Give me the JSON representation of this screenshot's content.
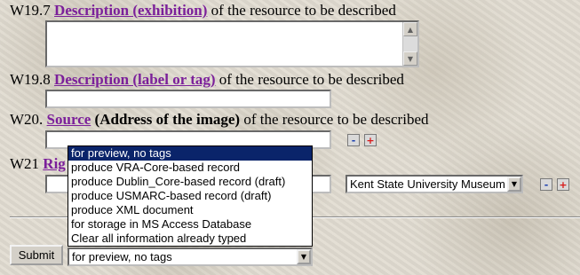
{
  "w19_7": {
    "number": "W19.7",
    "link": "Description (exhibition)",
    "suffix": "of the resource to be described",
    "value": ""
  },
  "w19_8": {
    "number": "W19.8",
    "link": "Description (label or tag)",
    "suffix": "of the resource to be described",
    "value": ""
  },
  "w20": {
    "number": "W20.",
    "link": "Source",
    "bold": "(Address of the image)",
    "suffix": "of the resource to be described",
    "value": ""
  },
  "w21": {
    "number": "W21",
    "link_visible": "Rig",
    "value": "",
    "select_value": "Kent State University Museum"
  },
  "controls": {
    "minus": "-",
    "plus": "+"
  },
  "output_format": {
    "options": [
      "for preview, no tags",
      "produce VRA-Core-based record",
      "produce Dublin_Core-based record (draft)",
      "produce USMARC-based record (draft)",
      "produce XML document",
      "for storage in MS Access Database",
      "Clear all information already typed"
    ],
    "selected": "for preview, no tags"
  },
  "submit": {
    "label": "Submit"
  },
  "colors": {
    "link": "#7b1f9a",
    "highlight": "#0a246a",
    "background": "#e2ddd2"
  }
}
